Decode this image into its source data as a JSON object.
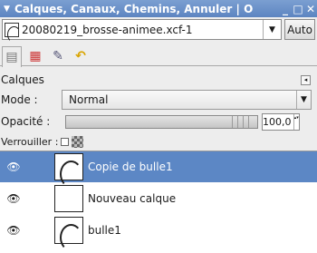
{
  "window": {
    "title": "Calques, Canaux, Chemins, Annuler | O",
    "menu_glyph": "▼",
    "minimize_glyph": "_",
    "maximize_glyph": "□",
    "close_glyph": "✕"
  },
  "image_selector": {
    "name": "20080219_brosse-animee.xcf-1",
    "arrow": "▼",
    "auto_label": "Auto"
  },
  "tabs": [
    {
      "icon": "layers-icon",
      "glyph": "▤"
    },
    {
      "icon": "channels-icon",
      "glyph": "▦"
    },
    {
      "icon": "paths-icon",
      "glyph": "✎"
    },
    {
      "icon": "undo-icon",
      "glyph": "↶"
    }
  ],
  "panel": {
    "title": "Calques",
    "menu_glyph": "◂"
  },
  "mode": {
    "label": "Mode :",
    "value": "Normal",
    "arrow": "▼"
  },
  "opacity": {
    "label": "Opacité :",
    "value": "100,0",
    "fraction": 1.0,
    "spin_glyph": "▴▾"
  },
  "lock": {
    "label": "Verrouiller :"
  },
  "layers": [
    {
      "name": "Copie de bulle1",
      "visible_glyph": "👁",
      "selected": true
    },
    {
      "name": "Nouveau calque",
      "visible_glyph": "👁",
      "selected": false
    },
    {
      "name": "bulle1",
      "visible_glyph": "👁",
      "selected": false
    }
  ],
  "colors": {
    "selection": "#5c87c5",
    "titlebar": "#6a90c8"
  }
}
